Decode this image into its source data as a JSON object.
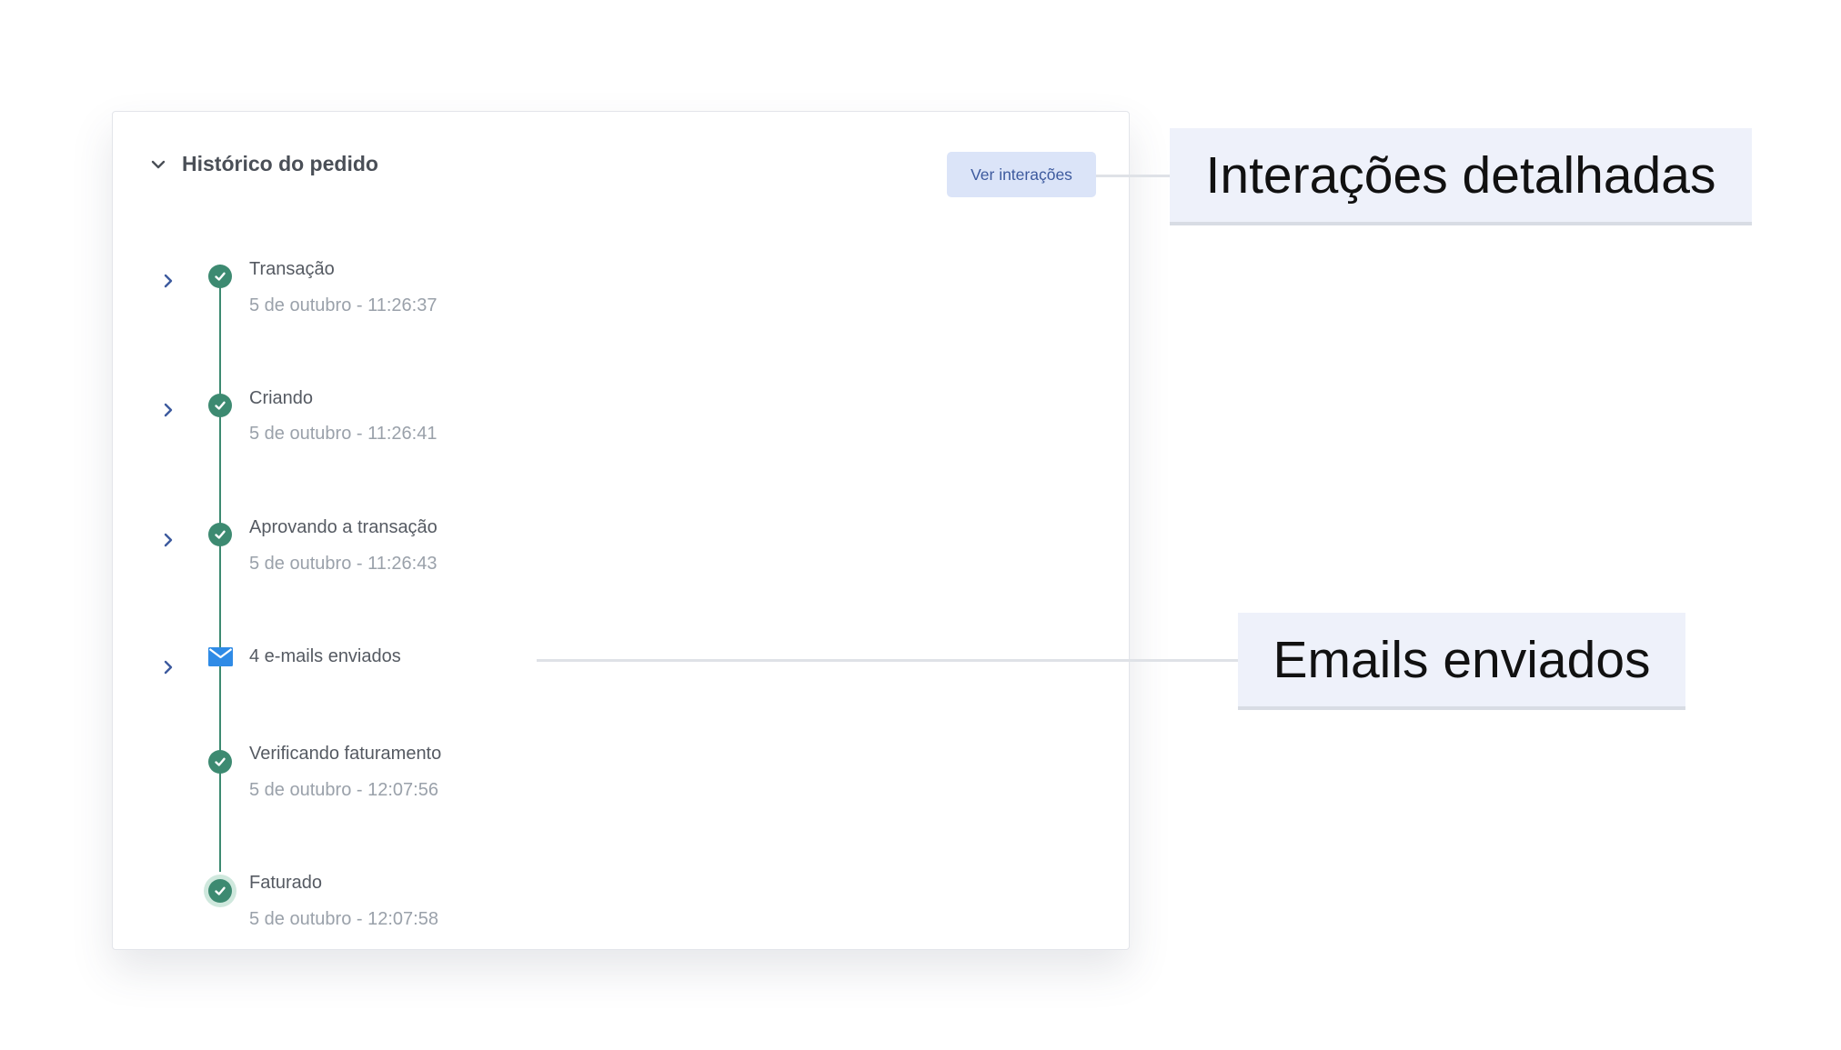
{
  "card": {
    "title": "Histórico do pedido",
    "interactions_button": "Ver interações"
  },
  "events": [
    {
      "title": "Transação",
      "date": "5 de outubro - 11:26:37",
      "icon": "check-circle-icon",
      "expandable": true
    },
    {
      "title": "Criando",
      "date": "5 de outubro - 11:26:41",
      "icon": "check-circle-icon",
      "expandable": true
    },
    {
      "title": "Aprovando a transação",
      "date": "5 de outubro - 11:26:43",
      "icon": "check-circle-icon",
      "expandable": true
    },
    {
      "title": "4 e-mails enviados",
      "icon": "mail-icon",
      "expandable": true
    },
    {
      "title": "Verificando faturamento",
      "date": "5 de outubro - 12:07:56",
      "icon": "check-circle-icon",
      "expandable": false
    },
    {
      "title": "Faturado",
      "date": "5 de outubro - 12:07:58",
      "icon": "check-circle-icon",
      "expandable": false
    }
  ],
  "callouts": {
    "interactions": "Interações detalhadas",
    "emails": "Emails enviados"
  },
  "colors": {
    "success": "#3d8a71",
    "mail": "#2f8be6",
    "accent": "#3d5a9e",
    "button_bg": "#dbe4f8",
    "callout_bg": "#eef1fa"
  }
}
